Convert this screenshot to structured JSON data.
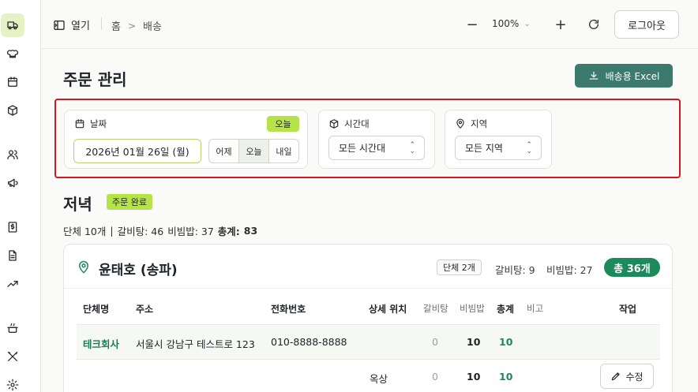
{
  "topbar": {
    "open_label": "열기",
    "breadcrumb": [
      "홈",
      "배송"
    ],
    "zoom": "100%",
    "logout_label": "로그아웃"
  },
  "page": {
    "title": "주문 관리",
    "excel_label": "배송용 Excel"
  },
  "filters": {
    "date": {
      "label": "날짜",
      "badge": "오늘",
      "value": "2026년 01월 26일 (월)",
      "quick": [
        "어제",
        "오늘",
        "내일"
      ],
      "selected_quick": "오늘"
    },
    "time": {
      "label": "시간대",
      "value": "모든 시간대"
    },
    "region": {
      "label": "지역",
      "value": "모든 지역"
    }
  },
  "section": {
    "title": "저녁",
    "status": "주문 완료",
    "summary": {
      "groups": "단체 10개",
      "separator": "|",
      "galbi": "갈비탕: 46",
      "bibim": "비빔밥: 37",
      "total_label": "총계:",
      "total_value": "83"
    }
  },
  "group": {
    "name": "윤태호 (송파)",
    "units": "단체 2개",
    "galbi": "갈비탕: 9",
    "bibim": "비빔밥: 27",
    "total": "총 36개",
    "columns": [
      "단체명",
      "주소",
      "전화번호",
      "상세 위치",
      "갈비탕",
      "비빔밥",
      "총계",
      "비고",
      "작업"
    ],
    "rows": [
      {
        "name": "테크회사",
        "address": "서울시 강남구 테스트로 123",
        "phone": "010-8888-8888",
        "location": "",
        "galbi": "0",
        "bibim": "10",
        "total": "10",
        "note": ""
      },
      {
        "name": "",
        "address": "",
        "phone": "",
        "location": "옥상",
        "galbi": "0",
        "bibim": "10",
        "total": "10",
        "note": "",
        "action": "수정"
      }
    ]
  },
  "colors": {
    "accent": "#b7e34a",
    "primary": "#1c8a5a",
    "excel": "#3d7a6e",
    "highlight": "#d0181e"
  }
}
